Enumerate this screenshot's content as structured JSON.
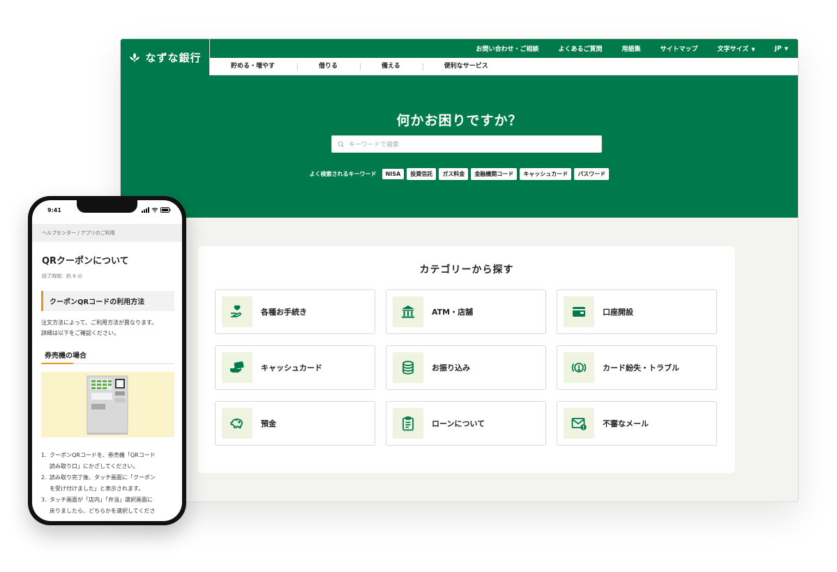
{
  "desktop": {
    "logo": "なずな銀行",
    "top_links": [
      "お問い合わせ・ご相談",
      "よくあるご質問",
      "用語集",
      "サイトマップ"
    ],
    "font_size_label": "文字サイズ",
    "lang_label": "JP",
    "main_nav": [
      "貯める・増やす",
      "借りる",
      "備える",
      "便利なサービス"
    ],
    "hero_title": "何かお困りですか？",
    "search_placeholder": "キーワードで検索",
    "keywords_label": "よく検索されるキーワード",
    "keywords": [
      "NISA",
      "投資信託",
      "ガス料金",
      "金融機関コード",
      "キャッシュカード",
      "パスワード"
    ],
    "categories_title": "カテゴリーから探す",
    "categories": [
      {
        "label": "各種お手続き",
        "icon": "hand-heart-icon"
      },
      {
        "label": "ATM・店舗",
        "icon": "bank-icon"
      },
      {
        "label": "口座開設",
        "icon": "wallet-icon"
      },
      {
        "label": "キャッシュカード",
        "icon": "card-hand-icon"
      },
      {
        "label": "お振り込み",
        "icon": "coins-icon"
      },
      {
        "label": "カード紛失・トラブル",
        "icon": "alert-circle-icon"
      },
      {
        "label": "預金",
        "icon": "piggy-bank-icon"
      },
      {
        "label": "ローンについて",
        "icon": "clipboard-icon"
      },
      {
        "label": "不審なメール",
        "icon": "mail-alert-icon"
      }
    ],
    "colors": {
      "brand": "#007a4d",
      "icon_bg": "#eef4df",
      "accent": "#e8971e"
    }
  },
  "phone": {
    "time": "9:41",
    "breadcrumb": "ヘルプセンター / アプリのご利用",
    "title": "QRクーポンについて",
    "read_time": "読了時間：約 8 分",
    "section_title": "クーポンQRコードの利用方法",
    "intro_line1": "注文方法によって、ご利用方法が異なります。",
    "intro_line2": "詳細は以下をご確認ください。",
    "subsection_title": "券売機の場合",
    "steps": [
      {
        "num": "1.",
        "line1": "クーポンQRコードを、券売機「QRコード",
        "line2": "読み取り口」にかざしてください。"
      },
      {
        "num": "2.",
        "line1": "読み取り完了後、タッチ画面に「クーポン",
        "line2": "を受け付けました」と表示されます。"
      },
      {
        "num": "3.",
        "line1": "タッチ画面が「店内」「弁当」選択画面に",
        "line2": "戻りましたら、どちらかを選択してくださ"
      }
    ]
  }
}
